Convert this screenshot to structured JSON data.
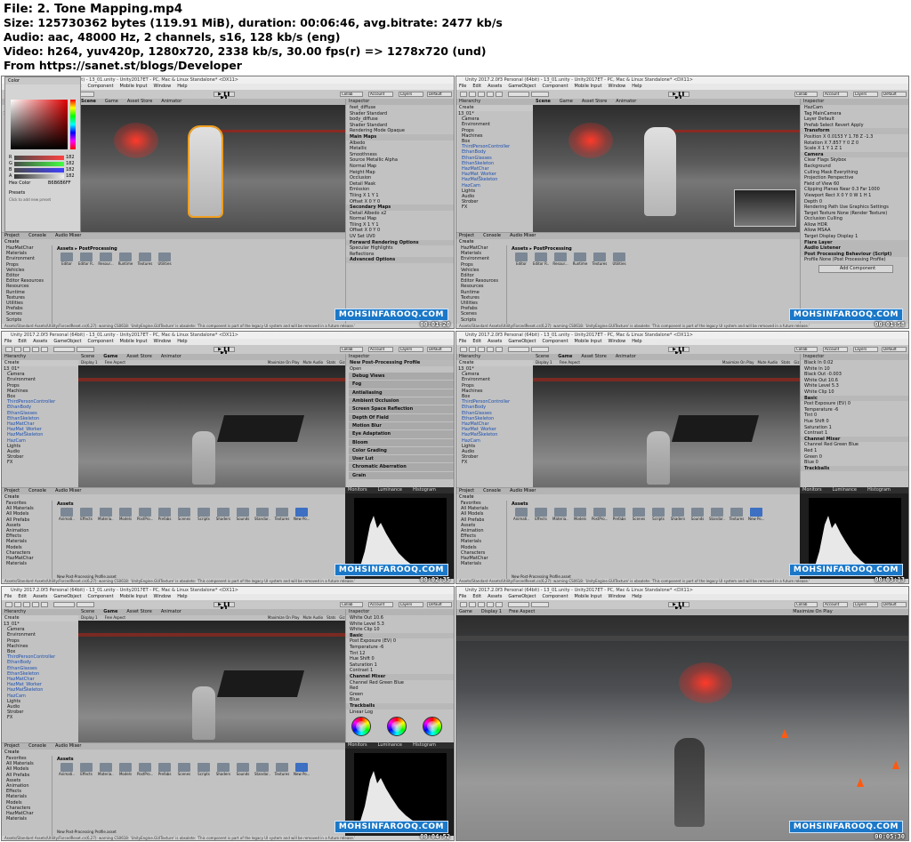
{
  "header": {
    "file_line": "File: 2. Tone Mapping.mp4",
    "size_line": "Size: 125730362 bytes (119.91 MiB), duration: 00:06:46, avg.bitrate: 2477 kb/s",
    "audio_line": "Audio: aac, 48000 Hz, 2 channels, s16, 128 kb/s (eng)",
    "video_line": "Video: h264, yuv420p, 1280x720, 2338 kb/s, 30.00 fps(r) => 1278x720 (und)",
    "source_line": "From https://sanet.st/blogs/Developer"
  },
  "window": {
    "title": "Unity 2017.2.0f3 Personal (64bit) - 13_01.unity - Unity2017ET - PC, Mac & Linux Standalone* <DX11>",
    "menu": [
      "File",
      "Edit",
      "Assets",
      "GameObject",
      "Component",
      "Mobile Input",
      "Window",
      "Help"
    ],
    "toolbar": {
      "pivot": "Pivot",
      "local": "Local",
      "collab": "Collab",
      "account": "Account",
      "layers": "Layers",
      "layout": "Default"
    }
  },
  "hierarchy": {
    "title": "Hierarchy",
    "create": "Create",
    "items": [
      "13_01*",
      "Camera",
      "Environment",
      "Props",
      "Machines",
      "Box",
      "ThirdPersonController",
      "EthanBody",
      "EthanGlasses",
      "EthanSkeleton",
      "HazMatChar",
      "HazMat_Worker",
      "HazMatSkeleton",
      "HazCam",
      "Lights",
      "Audio",
      "Strober",
      "FX"
    ],
    "blue_items": [
      "ThirdPersonController",
      "EthanBody",
      "EthanGlasses",
      "EthanSkeleton",
      "HazMatChar",
      "HazMat_Worker",
      "HazMatSkeleton",
      "HazCam"
    ]
  },
  "scene_tabs": [
    "Scene",
    "Game",
    "Asset Store",
    "Animator"
  ],
  "game_tabs": {
    "display": "Display 1",
    "aspect": "Free Aspect",
    "maximize": "Maximize On Play",
    "mute": "Mute Audio",
    "stats": "Stats",
    "gizmos": "Gizmos"
  },
  "project": {
    "tabs": [
      "Project",
      "Console",
      "Audio Mixer"
    ],
    "create": "Create",
    "crumb_post": "Assets ▸ PostProcessing",
    "crumb_assets": "Assets",
    "tree_a": [
      "HazMatChar",
      "Materials",
      "Environment",
      "Props",
      "Vehicles",
      "Editor",
      "Editor Resources",
      "Resources",
      "Runtime",
      "Textures",
      "Utilities",
      "Prefabs",
      "Scenes",
      "Scripts"
    ],
    "tree_b": [
      "Favorites",
      "All Materials",
      "All Models",
      "All Prefabs",
      "Assets",
      "Animation",
      "Effects",
      "Materials",
      "Models",
      "Characters",
      "HazMatChar",
      "Materials"
    ],
    "folders_a": [
      "Editor",
      "Editor R...",
      "Resour...",
      "Runtime",
      "Textures",
      "Utilities"
    ],
    "folders_b": [
      "Animati...",
      "Effects",
      "Materia...",
      "Models",
      "PostPro...",
      "Prefabs",
      "Scenes",
      "Scripts",
      "Shaders",
      "Sounds",
      "Standar...",
      "Textures",
      "New Po..."
    ],
    "selected_asset": "New Post-Processing Profile.asset",
    "assetbundle": "AssetBundle"
  },
  "inspector": {
    "title": "Inspector",
    "material_panel": [
      "feet_diffuse",
      "Shader  Standard",
      "body_diffuse",
      "Shader  Standard",
      "Rendering Mode  Opaque",
      "Main Maps",
      "Albedo",
      "Metallic",
      "Smoothness",
      "Source  Metallic Alpha",
      "Normal Map",
      "Height Map",
      "Occlusion",
      "Detail Mask",
      "Emission",
      "Tiling  X 1  Y 1",
      "Offset  X 0  Y 0",
      "Secondary Maps",
      "Detail Albedo x2",
      "Normal Map",
      "Tiling  X 1  Y 1",
      "Offset  X 0  Y 0",
      "UV Set  UV0",
      "Forward Rendering Options",
      "Specular Highlights",
      "Reflections",
      "Advanced Options"
    ],
    "camera_panel": [
      "HazCam",
      "Tag  MainCamera",
      "Layer  Default",
      "Prefab  Select  Revert  Apply",
      "Transform",
      "Position  X 0.0153  Y 1.78  Z -1.3",
      "Rotation  X 7.857  Y 0  Z 0",
      "Scale  X 1  Y 1  Z 1",
      "Camera",
      "Clear Flags  Skybox",
      "Background",
      "Culling Mask  Everything",
      "Projection  Perspective",
      "Field of View  60",
      "Clipping Planes  Near 0.3  Far 1000",
      "Viewport Rect  X 0  Y 0  W 1  H 1",
      "Depth  0",
      "Rendering Path  Use Graphics Settings",
      "Target Texture  None (Render Texture)",
      "Occlusion Culling",
      "Allow HDR",
      "Allow MSAA",
      "Target Display  Display 1",
      "Flare Layer",
      "Audio Listener",
      "Post Processing Behaviour (Script)",
      "Profile  None (Post Processing Profile)",
      "Add Component"
    ],
    "profile_panel": [
      "New Post-Processing Profile",
      "Open",
      "Debug Views",
      "Fog",
      "Antialiasing",
      "Ambient Occlusion",
      "Screen Space Reflection",
      "Depth Of Field",
      "Motion Blur",
      "Eye Adaptation",
      "Bloom",
      "Color Grading",
      "User Lut",
      "Chromatic Aberration",
      "Grain"
    ],
    "grading_panel": [
      "Black In  0.02",
      "White In  10",
      "Black Out  -0.003",
      "White Out  10.6",
      "White Level  5.3",
      "White Clip  10",
      "Basic",
      "Post Exposure (EV)  0",
      "Temperature  -6",
      "Tint  0",
      "Hue Shift  0",
      "Saturation  1",
      "Contrast  1",
      "Channel Mixer",
      "Channel  Red  Green  Blue",
      "Red  1",
      "Green  0",
      "Blue  0",
      "Trackballs"
    ],
    "grading_panel_b": [
      "White Out  10.6",
      "White Level  5.3",
      "White Clip  10",
      "Basic",
      "Post Exposure (EV)  0",
      "Temperature  -6",
      "Tint  12",
      "Hue Shift  0",
      "Saturation  1",
      "Contrast  1",
      "Channel Mixer",
      "Channel  Red  Green  Blue",
      "Red",
      "Green",
      "Blue",
      "Trackballs",
      "Linear  Log"
    ]
  },
  "histogram": {
    "tabs": [
      "Monitors",
      "Luminance",
      "Histogram"
    ]
  },
  "colorpicker": {
    "title": "Color",
    "r": "R",
    "g": "G",
    "b": "B",
    "a": "A",
    "r_val": "182",
    "g_val": "182",
    "b_val": "182",
    "a_val": "182",
    "hex_label": "Hex Color",
    "hex_val": "B6B6B6FF",
    "presets": "Presets",
    "presets_hint": "Click to add new preset"
  },
  "status": "Assets/Standard Assets/Utility/ForcedReset.cs(6,27): warning CS0618: 'UnityEngine.GUITexture' is obsolete: 'This component is part of the legacy UI system and will be removed in a future release.'",
  "watermark": "MOHSINFAROOQ.COM",
  "timestamps": [
    "00:01:20",
    "00:01:58",
    "00:02:35",
    "00:03:13",
    "00:04:52",
    "00:05:30"
  ],
  "colors": {
    "accent": "#1b78c8",
    "blue_text": "#1b4fb0",
    "panel": "#c2c2c2"
  }
}
